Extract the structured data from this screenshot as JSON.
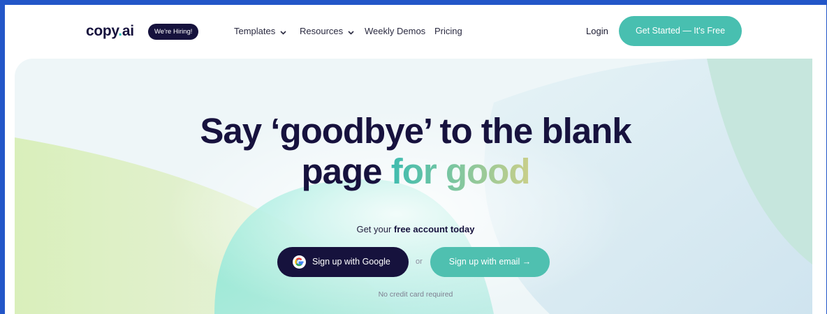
{
  "nav": {
    "logo": {
      "text_main": "copy",
      "text_dot": ".",
      "text_ai": "ai"
    },
    "hiring_badge": "We're Hiring!",
    "items": [
      {
        "label": "Templates",
        "has_dropdown": true,
        "icon": "chevron-down-icon"
      },
      {
        "label": "Resources",
        "has_dropdown": true,
        "icon": "chevron-down-icon"
      },
      {
        "label": "Weekly Demos",
        "has_dropdown": false
      },
      {
        "label": "Pricing",
        "has_dropdown": false
      }
    ],
    "login": "Login",
    "cta": "Get Started — It's Free"
  },
  "hero": {
    "headline_line1": "Say ‘goodbye’ to the blank",
    "headline_line2_plain": "page",
    "headline_line2_gradient": "for good",
    "subtitle_prefix": "Get your",
    "subtitle_bold": "free account today",
    "google_button": "Sign up with Google",
    "google_icon": "google-g-icon",
    "or_text": "or",
    "email_button": "Sign up with email →",
    "note": "No credit card required"
  },
  "colors": {
    "brand_dark": "#16123d",
    "brand_teal": "#48bfb0",
    "frame_border": "#2356c8",
    "logo_dot": "#2ec4b6"
  }
}
